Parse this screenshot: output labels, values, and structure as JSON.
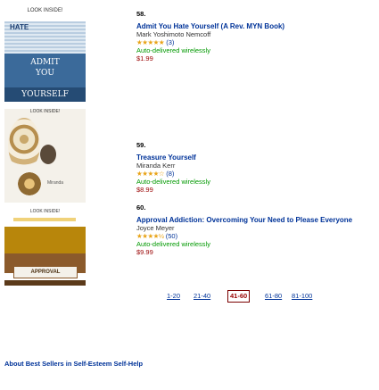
{
  "items": [
    {
      "rank": "58.",
      "title": "Admit You Hate Yourself (A Rev. MYN Book)",
      "author": "Mark Yoshimoto Nemcoff",
      "stars": "★★★★★",
      "rating_count": "(3)",
      "shipping": "Auto-delivered wirelessly",
      "price": "$1.99",
      "cover": {
        "top": "LOOK INSIDE!",
        "grid_text": "HATE",
        "mid": "ADMIT\nYOU",
        "bot": "YOURSELF"
      }
    },
    {
      "rank": "59.",
      "title": "Treasure Yourself",
      "author": "Miranda Kerr",
      "stars": "★★★★☆",
      "rating_count": "(8)",
      "shipping": "Auto-delivered wirelessly",
      "price": "$8.99",
      "cover": {
        "top": "LOOK INSIDE!",
        "name": "Miranda"
      }
    },
    {
      "rank": "60.",
      "title": "Approval Addiction: Overcoming Your Need to Please Everyone",
      "author": "Joyce Meyer",
      "stars": "★★★★½",
      "rating_count": "(50)",
      "shipping": "Auto-delivered wirelessly",
      "price": "$9.99",
      "cover": {
        "top": "LOOK INSIDE!",
        "label": "APPROVAL"
      }
    }
  ],
  "pagination": {
    "pages": [
      "1-20",
      "21-40",
      "41-60",
      "61-80",
      "81-100"
    ],
    "current": "41-60"
  },
  "footer": {
    "title": "About Best Sellers in Self-Esteem Self-Help"
  },
  "colors": {
    "link": "#003399",
    "price": "#990000",
    "shipping": "#009900",
    "stars": "#e8a317"
  }
}
